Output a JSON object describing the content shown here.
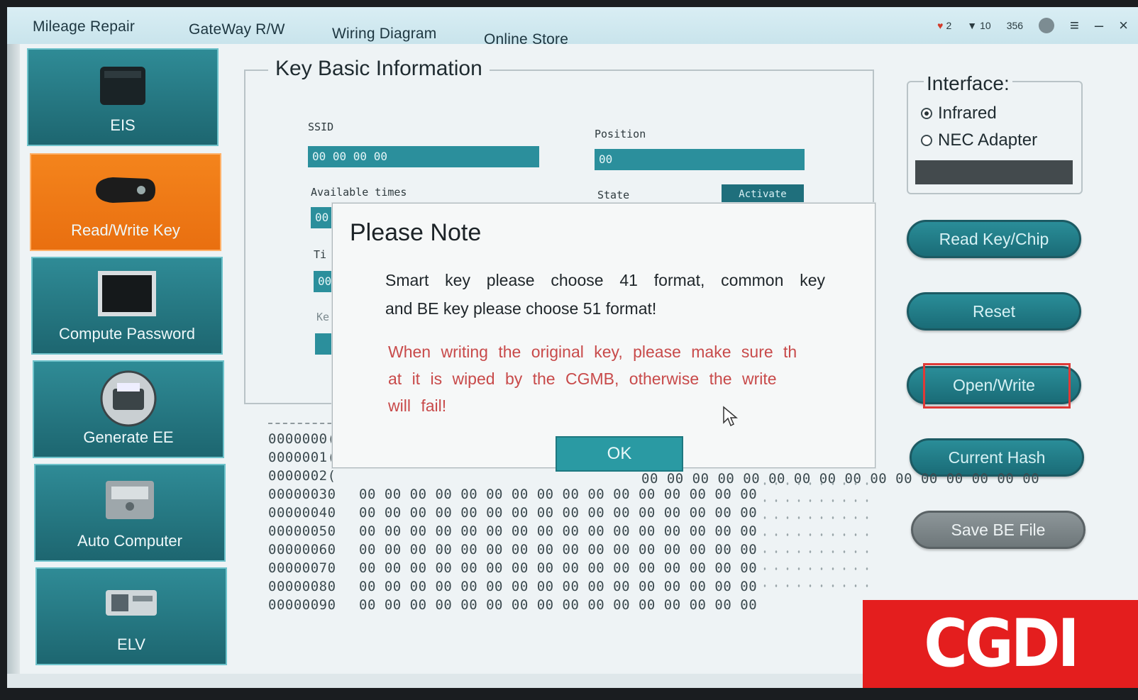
{
  "topbar": {
    "menu": [
      "Mileage Repair",
      "GateWay R/W",
      "Wiring Diagram",
      "Online Store"
    ],
    "tray": [
      "2",
      "10",
      "356"
    ]
  },
  "sidebar": {
    "items": [
      {
        "label": "EIS",
        "icon": "eis-module-icon"
      },
      {
        "label": "Read/Write Key",
        "icon": "car-key-icon"
      },
      {
        "label": "Compute Password",
        "icon": "monitor-icon"
      },
      {
        "label": "Generate EE",
        "icon": "printer-icon"
      },
      {
        "label": "Auto Computer",
        "icon": "ecu-icon"
      },
      {
        "label": "ELV",
        "icon": "elv-module-icon"
      }
    ],
    "active_index": 1
  },
  "key_info": {
    "title": "Key Basic Information",
    "ssid_label": "SSID",
    "ssid_value": "00 00 00 00",
    "position_label": "Position",
    "position_value": "00",
    "available_label": "Available times",
    "available_value": "00",
    "state_label": "State",
    "state_button": "Activate",
    "times_label_partial": "Ti",
    "times_value": "00",
    "key_label_partial": "Ke"
  },
  "interface": {
    "title": "Interface:",
    "options": [
      "Infrared",
      "NEC Adapter"
    ],
    "selected": "Infrared"
  },
  "buttons": {
    "read": "Read Key/Chip",
    "reset": "Reset",
    "open_write": "Open/Write",
    "current_hash": "Current Hash",
    "save_be": "Save BE File"
  },
  "hex": {
    "rows": [
      {
        "addr": "0000000(",
        "bytes": ""
      },
      {
        "addr": "0000001(",
        "bytes": ""
      },
      {
        "addr": "0000002(",
        "bytes": ""
      },
      {
        "addr": "00000030",
        "bytes": "00 00 00 00 00 00 00 00 00 00 00 00 00 00 00 00"
      },
      {
        "addr": "00000040",
        "bytes": "00 00 00 00 00 00 00 00 00 00 00 00 00 00 00 00"
      },
      {
        "addr": "00000050",
        "bytes": "00 00 00 00 00 00 00 00 00 00 00 00 00 00 00 00"
      },
      {
        "addr": "00000060",
        "bytes": "00 00 00 00 00 00 00 00 00 00 00 00 00 00 00 00"
      },
      {
        "addr": "00000070",
        "bytes": "00 00 00 00 00 00 00 00 00 00 00 00 00 00 00 00"
      },
      {
        "addr": "00000080",
        "bytes": "00 00 00 00 00 00 00 00 00 00 00 00 00 00 00 00"
      },
      {
        "addr": "00000090",
        "bytes": "00 00 00 00 00 00 00 00 00 00 00 00 00 00 00 00"
      }
    ],
    "tail_bytes": "00 00 00 00 00 00 00 00 00 00 00 00 00 00 00 00"
  },
  "dialog": {
    "title": "Please Note",
    "message_line1": "Smart key please choose 41 format, common key",
    "message_line2": "and BE key please choose 51 format!",
    "warning_line1": "When writing the original key, please make sure th",
    "warning_line2": "at it is wiped by the CGMB, otherwise the write",
    "warning_line3": "will fail!",
    "ok_label": "OK"
  },
  "logo": {
    "text": "CGDI"
  },
  "colors": {
    "accent": "#2a8d98",
    "active": "#f4841c",
    "warning": "#c84a4a",
    "logo_bg": "#e41e1e",
    "highlight": "#e03a37"
  }
}
